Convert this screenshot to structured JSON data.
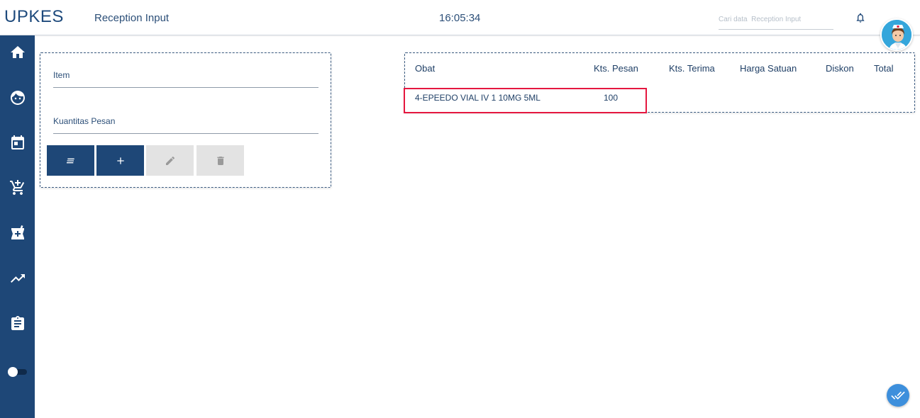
{
  "header": {
    "app_title": "UPKES",
    "page_title": "Reception Input",
    "clock": "16:05:34",
    "search_placeholder": "Cari data  Reception Input"
  },
  "sidebar": {
    "items": [
      {
        "icon": "home-icon"
      },
      {
        "icon": "face-icon"
      },
      {
        "icon": "calendar-icon"
      },
      {
        "icon": "add-cart-icon"
      },
      {
        "icon": "medical-icon"
      },
      {
        "icon": "trending-up-icon"
      },
      {
        "icon": "clipboard-icon"
      }
    ],
    "toggle": {
      "icon": "toggle-icon",
      "state": "off"
    }
  },
  "form": {
    "item_label": "Item",
    "item_value": "",
    "quantity_label": "Kuantitas Pesan",
    "quantity_value": "",
    "buttons": [
      {
        "icon": "list-icon",
        "enabled": true
      },
      {
        "icon": "plus-icon",
        "enabled": true
      },
      {
        "icon": "pencil-icon",
        "enabled": false
      },
      {
        "icon": "trash-icon",
        "enabled": false
      }
    ]
  },
  "table": {
    "columns": [
      "Obat",
      "Kts. Pesan",
      "Kts. Terima",
      "Harga Satuan",
      "Diskon",
      "Total"
    ],
    "rows": [
      {
        "obat": "4-EPEEDO VIAL IV 1 10MG 5ML",
        "kts_pesan": "100",
        "kts_terima": "",
        "harga_satuan": "",
        "diskon": "",
        "total": ""
      }
    ]
  },
  "fab": {
    "icon": "double-check-icon"
  },
  "colors": {
    "primary": "#1e4777",
    "highlight": "#e5173f",
    "fab": "#3d8fdc",
    "disabled": "#e3e3e3"
  }
}
